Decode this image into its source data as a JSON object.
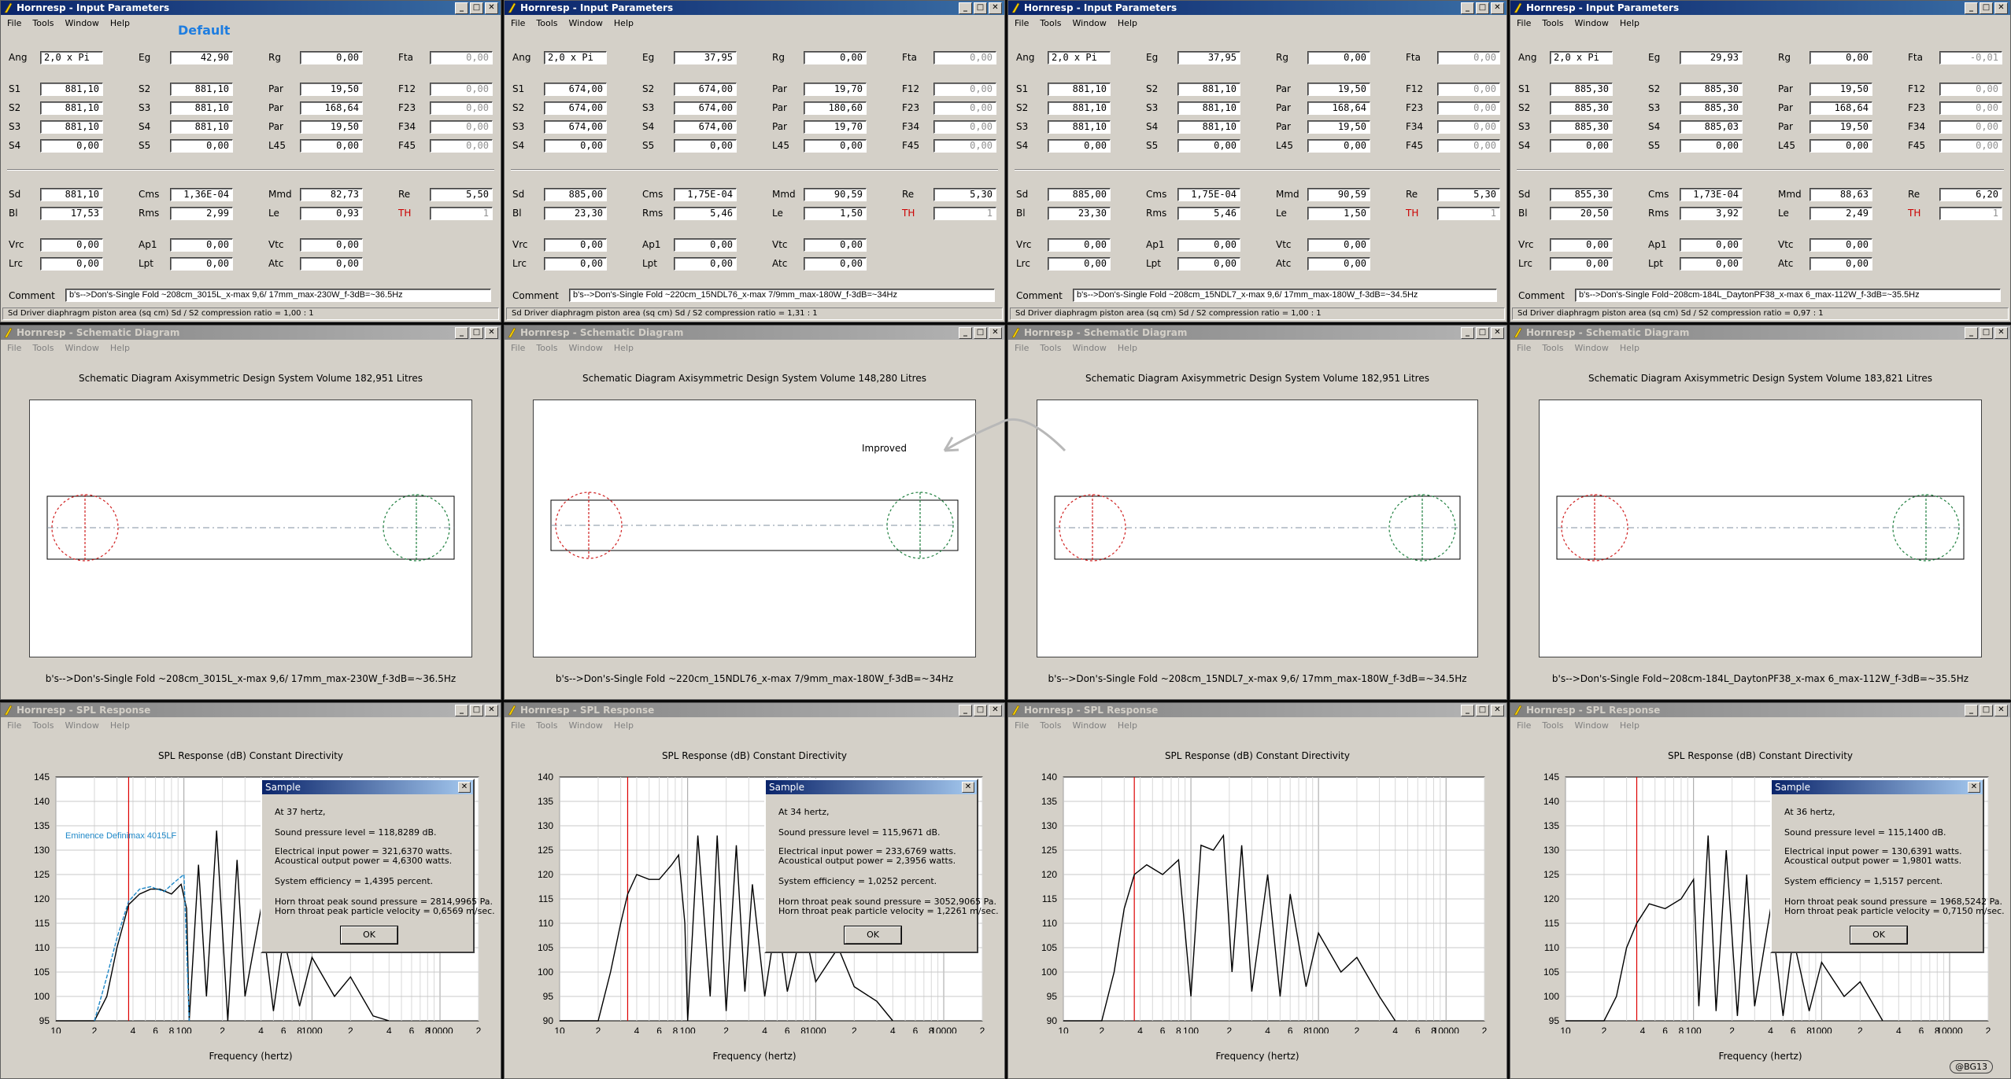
{
  "default_label": "Default",
  "improved_label": "Improved",
  "watermark": "@BG13",
  "menu": [
    "File",
    "Tools",
    "Window",
    "Help"
  ],
  "window_titles": {
    "input": "Hornresp - Input Parameters",
    "schematic": "Hornresp - Schematic Diagram",
    "spl": "Hornresp - SPL Response"
  },
  "labels": {
    "Ang": "Ang",
    "Eg": "Eg",
    "Rg": "Rg",
    "Fta": "Fta",
    "S1": "S1",
    "S2": "S2",
    "S3": "S3",
    "S4": "S4",
    "S5": "S5",
    "Par": "Par",
    "F12": "F12",
    "F23": "F23",
    "F34": "F34",
    "F45": "F45",
    "L45": "L45",
    "Sd": "Sd",
    "Cms": "Cms",
    "Mmd": "Mmd",
    "Re": "Re",
    "Bl": "Bl",
    "Rms": "Rms",
    "Le": "Le",
    "TH": "TH",
    "Vrc": "Vrc",
    "Ap1": "Ap1",
    "Vtc": "Vtc",
    "Lrc": "Lrc",
    "Lpt": "Lpt",
    "Atc": "Atc",
    "Comment": "Comment"
  },
  "schematic_title_prefix": "Schematic Diagram    Axisymmetric Design    System Volume",
  "spl_title": "SPL Response (dB)    Constant Directivity",
  "x_label": "Frequency (hertz)",
  "dialog_title": "Sample",
  "dialog_ok": "OK",
  "colors": {
    "titlebar_active": "#0a246a",
    "titlebar_inactive": "#808080",
    "window_bg": "#d4d0c8",
    "marker": "#dd0000",
    "overlay_series": "#1e88c8"
  },
  "panels": [
    {
      "inp": {
        "Ang": "2,0 x Pi",
        "Eg": "42,90",
        "Rg": "0,00",
        "Fta": "0,00",
        "S1": "881,10",
        "S2a": "881,10",
        "Par1": "19,50",
        "F12": "0,00",
        "S2": "881,10",
        "S3a": "881,10",
        "Par2": "168,64",
        "F23": "0,00",
        "S3": "881,10",
        "S4a": "881,10",
        "Par3": "19,50",
        "F34": "0,00",
        "S4": "0,00",
        "S5": "0,00",
        "L45": "0,00",
        "F45": "0,00",
        "Sd": "881,10",
        "Cms": "1,36E-04",
        "Mmd": "82,73",
        "Re": "5,50",
        "Bl": "17,53",
        "Rms": "2,99",
        "Le": "0,93",
        "TH": "1",
        "Vrc": "0,00",
        "Ap1": "0,00",
        "Vtc": "0,00",
        "Lrc": "0,00",
        "Lpt": "0,00",
        "Atc": "0,00"
      },
      "comment": "b's-->Don's-Single Fold ~208cm_3015L_x-max 9,6/ 17mm_max-230W_f-3dB=~36.5Hz",
      "status": "Sd  Driver diaphragm piston area  (sq cm)    Sd / S2 compression ratio = 1,00 : 1",
      "system_volume": "182,951 Litres",
      "schem_caption": "b's-->Don's-Single Fold ~208cm_3015L_x-max 9,6/ 17mm_max-230W_f-3dB=~36.5Hz",
      "chart": {
        "ymin": 95,
        "ymax": 145,
        "ticks": [
          "145",
          "140",
          "135",
          "130",
          "125",
          "120",
          "115",
          "110",
          "105",
          "100",
          "95"
        ]
      },
      "dialog": {
        "lines": [
          "At 37 hertz,",
          "Sound pressure level = 118,8289 dB.",
          "Electrical input power = 321,6370 watts.",
          "Acoustical output power = 4,6300 watts.",
          "System efficiency = 1,4395 percent.",
          "Horn throat peak sound pressure = 2814,9965 Pa.",
          "Horn throat peak particle velocity = 0,6569 m/sec."
        ]
      },
      "legend": "Eminence Definimax 4015LF"
    },
    {
      "inp": {
        "Ang": "2,0 x Pi",
        "Eg": "37,95",
        "Rg": "0,00",
        "Fta": "0,00",
        "S1": "674,00",
        "S2a": "674,00",
        "Par1": "19,70",
        "F12": "0,00",
        "S2": "674,00",
        "S3a": "674,00",
        "Par2": "180,60",
        "F23": "0,00",
        "S3": "674,00",
        "S4a": "674,00",
        "Par3": "19,70",
        "F34": "0,00",
        "S4": "0,00",
        "S5": "0,00",
        "L45": "0,00",
        "F45": "0,00",
        "Sd": "885,00",
        "Cms": "1,75E-04",
        "Mmd": "90,59",
        "Re": "5,30",
        "Bl": "23,30",
        "Rms": "5,46",
        "Le": "1,50",
        "TH": "1",
        "Vrc": "0,00",
        "Ap1": "0,00",
        "Vtc": "0,00",
        "Lrc": "0,00",
        "Lpt": "0,00",
        "Atc": "0,00"
      },
      "comment": "b's-->Don's-Single Fold ~220cm_15NDL76_x-max 7/9mm_max-180W_f-3dB=~34Hz",
      "status": "Sd  Driver diaphragm piston area  (sq cm)    Sd / S2 compression ratio = 1,31 : 1",
      "system_volume": "148,280 Litres",
      "schem_caption": "b's-->Don's-Single Fold ~220cm_15NDL76_x-max 7/9mm_max-180W_f-3dB=~34Hz",
      "chart": {
        "ymin": 90,
        "ymax": 140,
        "ticks": [
          "140",
          "135",
          "130",
          "125",
          "120",
          "115",
          "110",
          "105",
          "100",
          "95",
          "90"
        ]
      },
      "dialog": {
        "lines": [
          "At 34 hertz,",
          "Sound pressure level = 115,9671 dB.",
          "Electrical input power = 233,6769 watts.",
          "Acoustical output power = 2,3956 watts.",
          "System efficiency = 1,0252 percent.",
          "Horn throat peak sound pressure = 3052,9065 Pa.",
          "Horn throat peak particle velocity = 1,2261 m/sec."
        ]
      },
      "legend": ""
    },
    {
      "inp": {
        "Ang": "2,0 x Pi",
        "Eg": "37,95",
        "Rg": "0,00",
        "Fta": "0,00",
        "S1": "881,10",
        "S2a": "881,10",
        "Par1": "19,50",
        "F12": "0,00",
        "S2": "881,10",
        "S3a": "881,10",
        "Par2": "168,64",
        "F23": "0,00",
        "S3": "881,10",
        "S4a": "881,10",
        "Par3": "19,50",
        "F34": "0,00",
        "S4": "0,00",
        "S5": "0,00",
        "L45": "0,00",
        "F45": "0,00",
        "Sd": "885,00",
        "Cms": "1,75E-04",
        "Mmd": "90,59",
        "Re": "5,30",
        "Bl": "23,30",
        "Rms": "5,46",
        "Le": "1,50",
        "TH": "1",
        "Vrc": "0,00",
        "Ap1": "0,00",
        "Vtc": "0,00",
        "Lrc": "0,00",
        "Lpt": "0,00",
        "Atc": "0,00"
      },
      "comment": "b's-->Don's-Single Fold ~208cm_15NDL7_x-max 9,6/ 17mm_max-180W_f-3dB=~34.5Hz",
      "status": "Sd  Driver diaphragm piston area  (sq cm)    Sd / S2 compression ratio = 1,00 : 1",
      "system_volume": "182,951 Litres",
      "schem_caption": "b's-->Don's-Single Fold ~208cm_15NDL7_x-max 9,6/ 17mm_max-180W_f-3dB=~34.5Hz",
      "chart": {
        "ymin": 90,
        "ymax": 140,
        "ticks": [
          "140",
          "135",
          "130",
          "125",
          "120",
          "115",
          "110",
          "105",
          "100",
          "95",
          "90"
        ]
      },
      "dialog": null,
      "legend": ""
    },
    {
      "inp": {
        "Ang": "2,0 x Pi",
        "Eg": "29,93",
        "Rg": "0,00",
        "Fta": "-0,01",
        "S1": "885,30",
        "S2a": "885,30",
        "Par1": "19,50",
        "F12": "0,00",
        "S2": "885,30",
        "S3a": "885,30",
        "Par2": "168,64",
        "F23": "0,00",
        "S3": "885,30",
        "S4a": "885,03",
        "Par3": "19,50",
        "F34": "0,00",
        "S4": "0,00",
        "S5": "0,00",
        "L45": "0,00",
        "F45": "0,00",
        "Sd": "855,30",
        "Cms": "1,73E-04",
        "Mmd": "88,63",
        "Re": "6,20",
        "Bl": "20,50",
        "Rms": "3,92",
        "Le": "2,49",
        "TH": "1",
        "Vrc": "0,00",
        "Ap1": "0,00",
        "Vtc": "0,00",
        "Lrc": "0,00",
        "Lpt": "0,00",
        "Atc": "0,00"
      },
      "comment": "b's-->Don's-Single Fold~208cm-184L_DaytonPF38_x-max 6_max-112W_f-3dB=~35.5Hz",
      "status": "Sd  Driver diaphragm piston area  (sq cm)    Sd / S2 compression ratio = 0,97 : 1",
      "system_volume": "183,821 Litres",
      "schem_caption": "b's-->Don's-Single Fold~208cm-184L_DaytonPF38_x-max 6_max-112W_f-3dB=~35.5Hz",
      "chart": {
        "ymin": 95,
        "ymax": 145,
        "ticks": [
          "145",
          "140",
          "135",
          "130",
          "125",
          "120",
          "115",
          "110",
          "105",
          "100",
          "95"
        ]
      },
      "dialog": {
        "lines": [
          "At 36 hertz,",
          "Sound pressure level = 115,1400 dB.",
          "Electrical input power = 130,6391 watts.",
          "Acoustical output power = 1,9801 watts.",
          "System efficiency = 1,5157 percent.",
          "Horn throat peak sound pressure = 1968,5242 Pa.",
          "Horn throat peak particle velocity = 0,7150 m/sec."
        ]
      },
      "legend": ""
    }
  ],
  "x_ticks": [
    "10",
    "2",
    "4",
    "6",
    "8",
    "100",
    "2",
    "4",
    "6",
    "8",
    "1000",
    "2",
    "4",
    "6",
    "8",
    "10000",
    "2"
  ],
  "chart_data": [
    {
      "type": "line",
      "title": "SPL Response (dB)    Constant Directivity",
      "xlabel": "Frequency (hertz)",
      "xscale": "log",
      "xlim": [
        10,
        20000
      ],
      "ylim": [
        95,
        145
      ],
      "marker_hz": 37,
      "series": [
        {
          "name": "",
          "x": [
            10,
            15,
            20,
            25,
            30,
            37,
            45,
            55,
            65,
            80,
            95,
            105,
            110,
            130,
            150,
            180,
            220,
            260,
            300,
            400,
            500,
            600,
            800,
            1000,
            1500,
            2000,
            3000,
            4000
          ],
          "y": [
            40,
            70,
            88,
            100,
            110,
            118.8,
            121,
            122,
            122,
            121,
            123,
            118,
            95,
            127,
            100,
            134,
            95,
            128,
            100,
            118,
            97,
            112,
            98,
            108,
            100,
            104,
            96,
            92
          ]
        },
        {
          "name": "Eminence Definimax 4015LF",
          "x": [
            20,
            25,
            30,
            37,
            45,
            55,
            70,
            85,
            100,
            110
          ],
          "y": [
            95,
            104,
            112,
            119.5,
            122,
            122.5,
            121.5,
            123.5,
            125,
            95
          ]
        }
      ]
    },
    {
      "type": "line",
      "title": "SPL Response (dB)    Constant Directivity",
      "xlabel": "Frequency (hertz)",
      "xscale": "log",
      "xlim": [
        10,
        20000
      ],
      "ylim": [
        90,
        140
      ],
      "marker_hz": 34,
      "series": [
        {
          "x": [
            10,
            15,
            20,
            25,
            30,
            34,
            40,
            50,
            60,
            75,
            85,
            95,
            100,
            120,
            150,
            170,
            200,
            240,
            280,
            320,
            400,
            500,
            600,
            800,
            1000,
            1500,
            2000,
            3000,
            4000
          ],
          "y": [
            45,
            70,
            85,
            100,
            110,
            116,
            120,
            119,
            119,
            122,
            124,
            110,
            90,
            128,
            95,
            128,
            92,
            126,
            96,
            118,
            95,
            112,
            96,
            110,
            98,
            105,
            97,
            94,
            90
          ]
        }
      ]
    },
    {
      "type": "line",
      "title": "SPL Response (dB)    Constant Directivity",
      "xlabel": "Frequency (hertz)",
      "xscale": "log",
      "xlim": [
        10,
        20000
      ],
      "ylim": [
        90,
        140
      ],
      "marker_hz": 36,
      "series": [
        {
          "x": [
            10,
            15,
            20,
            25,
            30,
            36,
            45,
            60,
            80,
            100,
            120,
            150,
            180,
            210,
            250,
            300,
            400,
            500,
            600,
            800,
            1000,
            1500,
            2000,
            3000,
            4000
          ],
          "y": [
            45,
            70,
            85,
            100,
            113,
            120,
            122,
            120,
            123,
            95,
            126,
            125,
            128,
            100,
            126,
            96,
            120,
            95,
            116,
            97,
            108,
            100,
            103,
            95,
            90
          ]
        }
      ]
    },
    {
      "type": "line",
      "title": "SPL Response (dB)    Constant Directivity",
      "xlabel": "Frequency (hertz)",
      "xscale": "log",
      "xlim": [
        10,
        20000
      ],
      "ylim": [
        95,
        145
      ],
      "marker_hz": 36,
      "series": [
        {
          "x": [
            10,
            15,
            20,
            25,
            30,
            36,
            45,
            60,
            80,
            100,
            110,
            130,
            150,
            180,
            220,
            260,
            300,
            400,
            500,
            600,
            800,
            1000,
            1500,
            2000,
            3000
          ],
          "y": [
            40,
            68,
            88,
            100,
            110,
            115,
            119,
            118,
            120,
            124,
            98,
            133,
            97,
            130,
            96,
            125,
            98,
            118,
            96,
            112,
            97,
            107,
            100,
            103,
            95
          ]
        }
      ]
    }
  ]
}
